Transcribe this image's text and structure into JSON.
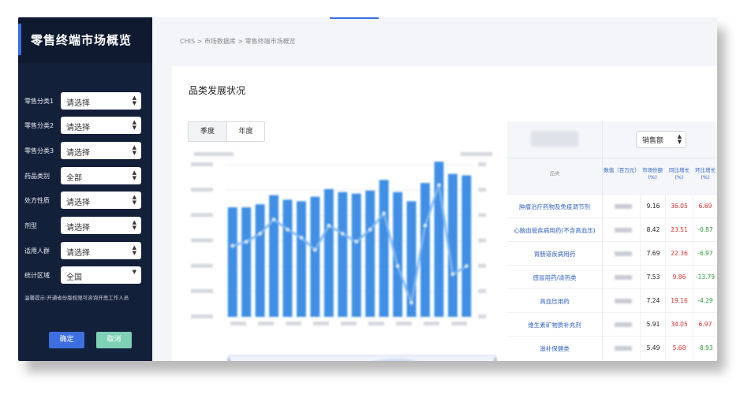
{
  "sidebar": {
    "title": "零售终端市场概览",
    "filters": [
      {
        "label": "零售分类1",
        "value": "请选择"
      },
      {
        "label": "零售分类2",
        "value": "请选择"
      },
      {
        "label": "零售分类3",
        "value": "请选择"
      },
      {
        "label": "药品类别",
        "value": "全部"
      },
      {
        "label": "处方性质",
        "value": "请选择"
      },
      {
        "label": "剂型",
        "value": "请选择"
      },
      {
        "label": "适用人群",
        "value": "请选择"
      },
      {
        "label": "统计区域",
        "value": "全国"
      }
    ],
    "hint": "温馨提示:开通省份版权限可咨询开思工作人员",
    "confirm_label": "确定",
    "cancel_label": "取消"
  },
  "breadcrumb": "CHIS > 市场数据库 > 零售终端市场概览",
  "panel": {
    "title": "品类发展状况",
    "period_tabs": [
      "季度",
      "年度"
    ],
    "metric_select": "销售额"
  },
  "table": {
    "headers": {
      "category": "品类",
      "sales": "数值（百万元）",
      "share": "市场份额(%)",
      "yoy": "同比增长(%)",
      "mom": "环比增长(%)"
    },
    "rows": [
      {
        "name": "肿瘤治疗药物及免疫调节剂",
        "share": "9.16",
        "yoy": "36.05",
        "mom": "6.69",
        "mom_sign": "pos"
      },
      {
        "name": "心脑血管疾病用药(不含高血压)",
        "share": "8.42",
        "yoy": "23.51",
        "mom": "-0.87",
        "mom_sign": "neg"
      },
      {
        "name": "胃肠道疾病用药",
        "share": "7.69",
        "yoy": "22.36",
        "mom": "-6.97",
        "mom_sign": "neg"
      },
      {
        "name": "感冒用药/清热类",
        "share": "7.53",
        "yoy": "9.86",
        "mom": "-13.79",
        "mom_sign": "neg"
      },
      {
        "name": "高血压用药",
        "share": "7.24",
        "yoy": "19.16",
        "mom": "-4.29",
        "mom_sign": "neg"
      },
      {
        "name": "维生素矿物质补充剂",
        "share": "5.91",
        "yoy": "34.05",
        "mom": "6.97",
        "mom_sign": "pos"
      },
      {
        "name": "滋补保健类",
        "share": "5.49",
        "yoy": "5.68",
        "mom": "-8.93",
        "mom_sign": "neg"
      }
    ]
  },
  "colors": {
    "bar": "#3f8fe6",
    "line": "#7fb7ef",
    "accent": "#3d6fe0",
    "confirm": "#3d6fe0",
    "cancel": "#7fd1b6",
    "sidebar_bg": "#13203a"
  },
  "chart_data": {
    "type": "bar",
    "note_blurred": true,
    "series": [
      {
        "values": [
          72,
          72,
          74,
          80,
          77,
          76,
          79,
          84,
          82,
          81,
          83,
          90,
          82,
          76,
          88,
          102,
          94,
          93
        ]
      },
      {
        "values": [
          20,
          22,
          26,
          33,
          28,
          24,
          18,
          30,
          26,
          22,
          28,
          36,
          10,
          -8,
          30,
          50,
          6,
          10
        ]
      }
    ],
    "ylim": [
      0,
      100
    ],
    "y2lim": [
      -15,
      60
    ]
  }
}
